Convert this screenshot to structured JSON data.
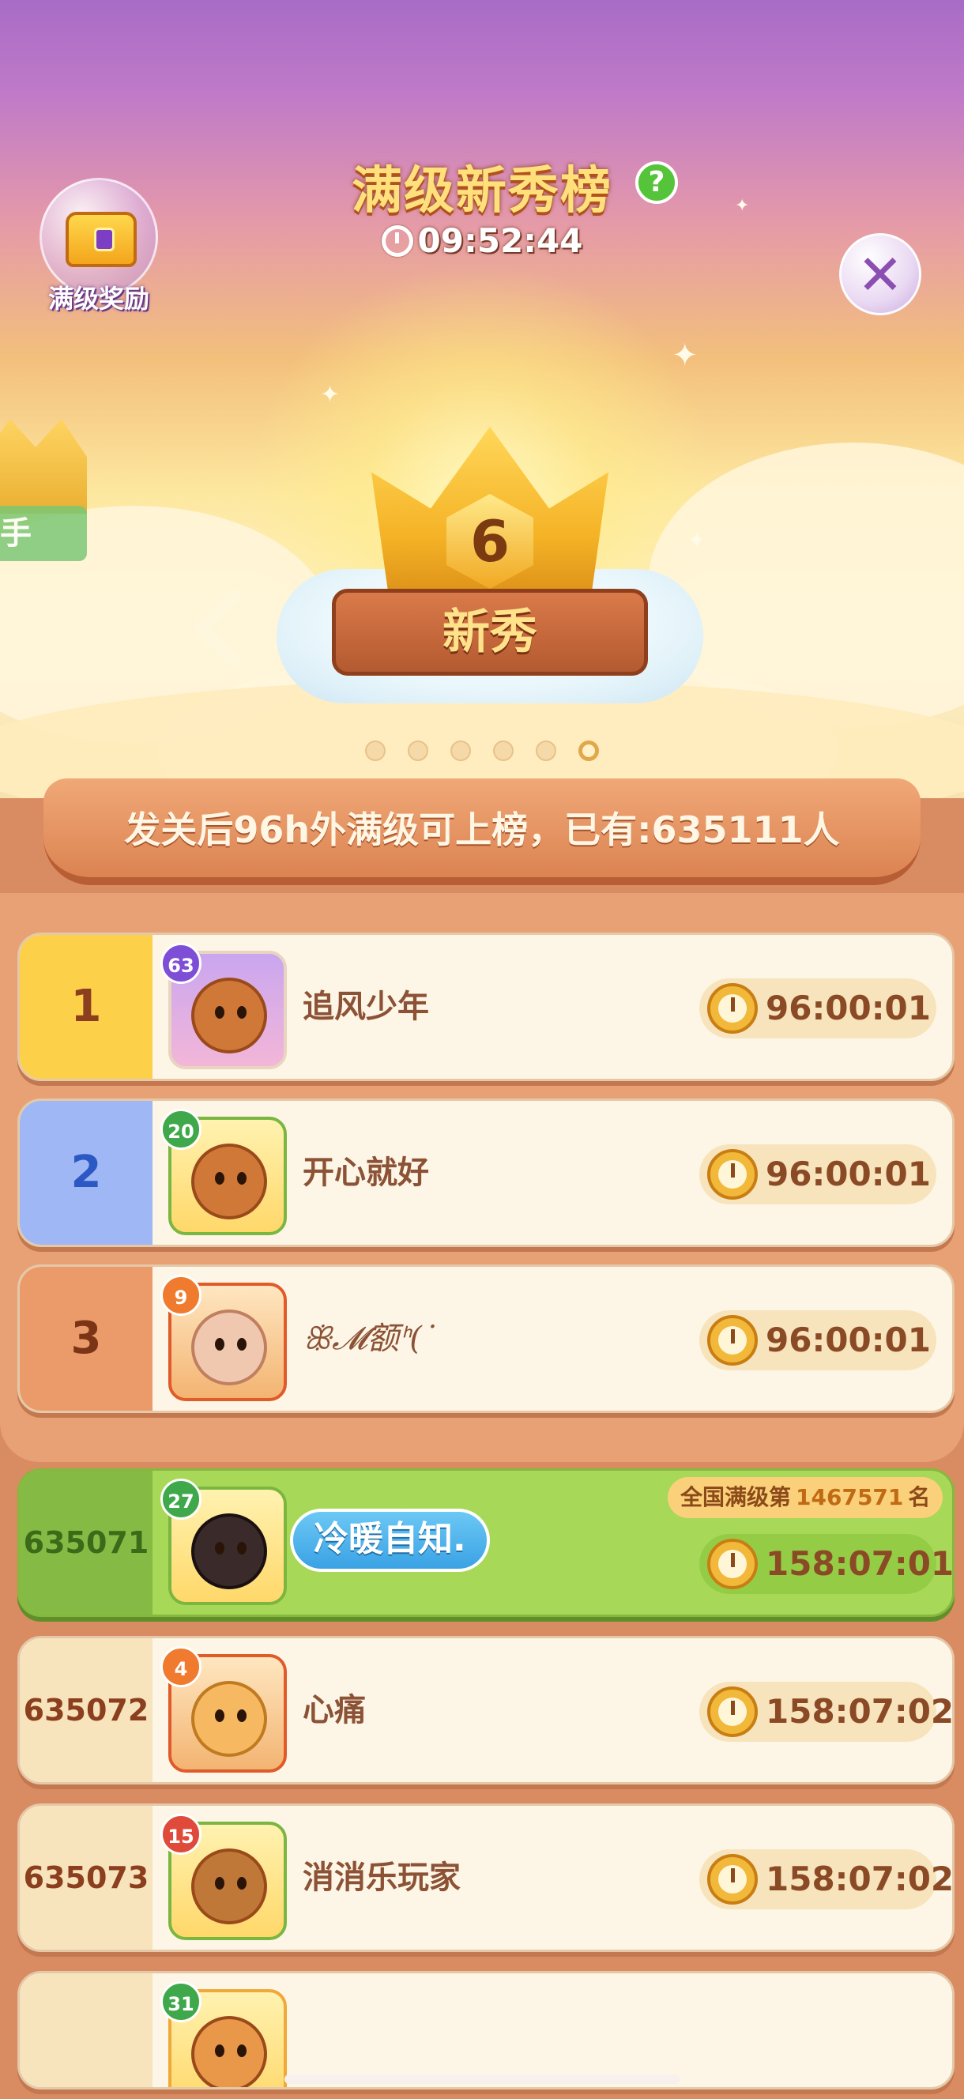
{
  "header": {
    "reward_label": "满级奖励",
    "title": "满级新秀榜",
    "help": "?",
    "countdown": "09:52:44",
    "close": "✕"
  },
  "side_badge": {
    "label": "手"
  },
  "current_rank": {
    "level": "6",
    "name": "新秀"
  },
  "carousel": {
    "count": 6,
    "active_index": 5
  },
  "banner": {
    "text": "发关后96h外满级可上榜，已有:635111人"
  },
  "top_rows": [
    {
      "rank": "1",
      "level": "63",
      "name": "追风少年",
      "time": "96:00:01"
    },
    {
      "rank": "2",
      "level": "20",
      "name": "开心就好",
      "time": "96:00:01"
    },
    {
      "rank": "3",
      "level": "9",
      "name": "ꕥ𝓜额ᑋ(˙",
      "time": "96:00:01"
    }
  ],
  "me_row": {
    "rank": "635071",
    "level": "27",
    "name": "冷暖自知.",
    "national_prefix": "全国满级第",
    "national_rank": "1467571",
    "national_suffix": "名",
    "time": "158:07:01"
  },
  "list_rows": [
    {
      "rank": "635072",
      "level": "4",
      "name": "心痛",
      "time": "158:07:02"
    },
    {
      "rank": "635073",
      "level": "15",
      "name": "消消乐玩家",
      "time": "158:07:02"
    },
    {
      "rank": "",
      "level": "31",
      "name": "",
      "time": ""
    }
  ],
  "colors": {
    "gold": "#fdd04a",
    "silver_blue": "#9fb7f5",
    "bronze": "#eb9b6a",
    "me_green": "#a8d858",
    "board": "#d98b62"
  }
}
